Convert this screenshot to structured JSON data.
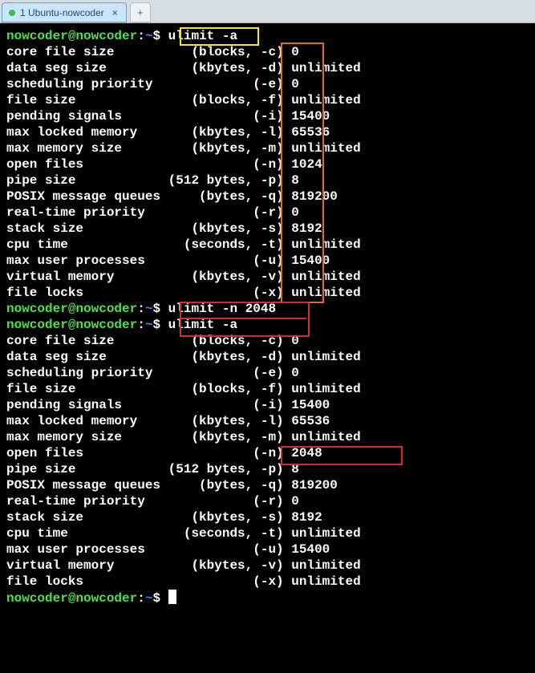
{
  "tab": {
    "title": "1 Ubuntu-nowcoder",
    "close": "×",
    "new": "+"
  },
  "prompt": {
    "user": "nowcoder@nowcoder",
    "sep": ":",
    "path": "~",
    "end": "$"
  },
  "commands": {
    "cmd1": "ulimit -a",
    "cmd2": "ulimit -n 2048",
    "cmd3": "ulimit -a"
  },
  "ulimit_rows_1": [
    {
      "label": "core file size          ",
      "unit": "(blocks, ",
      "flag": "-c)",
      "val": " 0"
    },
    {
      "label": "data seg size           ",
      "unit": "(kbytes, ",
      "flag": "-d)",
      "val": " unlimited"
    },
    {
      "label": "scheduling priority             ",
      "unit": "",
      "flag": "(-e)",
      "val": " 0"
    },
    {
      "label": "file size               ",
      "unit": "(blocks, ",
      "flag": "-f)",
      "val": " unlimited"
    },
    {
      "label": "pending signals                 ",
      "unit": "",
      "flag": "(-i)",
      "val": " 15400"
    },
    {
      "label": "max locked memory       ",
      "unit": "(kbytes, ",
      "flag": "-l)",
      "val": " 65536"
    },
    {
      "label": "max memory size         ",
      "unit": "(kbytes, ",
      "flag": "-m)",
      "val": " unlimited"
    },
    {
      "label": "open files                      ",
      "unit": "",
      "flag": "(-n)",
      "val": " 1024"
    },
    {
      "label": "pipe size            ",
      "unit": "(512 bytes, ",
      "flag": "-p)",
      "val": " 8"
    },
    {
      "label": "POSIX message queues     ",
      "unit": "(bytes, ",
      "flag": "-q)",
      "val": " 819200"
    },
    {
      "label": "real-time priority              ",
      "unit": "",
      "flag": "(-r)",
      "val": " 0"
    },
    {
      "label": "stack size              ",
      "unit": "(kbytes, ",
      "flag": "-s)",
      "val": " 8192"
    },
    {
      "label": "cpu time               ",
      "unit": "(seconds, ",
      "flag": "-t)",
      "val": " unlimited"
    },
    {
      "label": "max user processes              ",
      "unit": "",
      "flag": "(-u)",
      "val": " 15400"
    },
    {
      "label": "virtual memory          ",
      "unit": "(kbytes, ",
      "flag": "-v)",
      "val": " unlimited"
    },
    {
      "label": "file locks                      ",
      "unit": "",
      "flag": "(-x)",
      "val": " unlimited"
    }
  ],
  "ulimit_rows_2": [
    {
      "label": "core file size          (blocks, -c) ",
      "val": "0"
    },
    {
      "label": "data seg size           (kbytes, -d) ",
      "val": "unlimited"
    },
    {
      "label": "scheduling priority             (-e) ",
      "val": "0"
    },
    {
      "label": "file size               (blocks, -f) ",
      "val": "unlimited"
    },
    {
      "label": "pending signals                 (-i) ",
      "val": "15400"
    },
    {
      "label": "max locked memory       (kbytes, -l) ",
      "val": "65536"
    },
    {
      "label": "max memory size         (kbytes, -m) ",
      "val": "unlimited"
    },
    {
      "label": "open files                      ",
      "flagcol": "(-n) ",
      "val": "2048"
    },
    {
      "label": "pipe size            (512 bytes, -p) ",
      "val": "8"
    },
    {
      "label": "POSIX message queues     (bytes, -q) ",
      "val": "819200"
    },
    {
      "label": "real-time priority              (-r) ",
      "val": "0"
    },
    {
      "label": "stack size              (kbytes, -s) ",
      "val": "8192"
    },
    {
      "label": "cpu time               (seconds, -t) ",
      "val": "unlimited"
    },
    {
      "label": "max user processes              (-u) ",
      "val": "15400"
    },
    {
      "label": "virtual memory          (kbytes, -v) ",
      "val": "unlimited"
    },
    {
      "label": "file locks                      (-x) ",
      "val": "unlimited"
    }
  ]
}
